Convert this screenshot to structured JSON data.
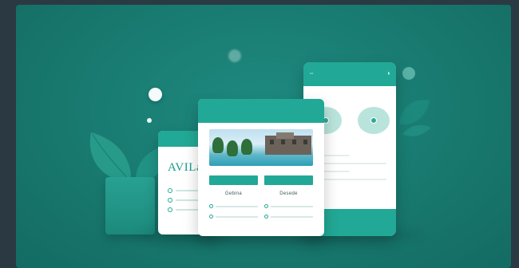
{
  "brand": {
    "logo_text": "AVILa",
    "tagline": "",
    "color_primary": "#22a896",
    "color_background": "#18796f"
  },
  "left_card": {
    "header": "",
    "subheading": ""
  },
  "center_card": {
    "header_left": "",
    "header_center": "",
    "header_right": "",
    "columns": [
      {
        "button_label": "",
        "title": "Gebina",
        "subtitle": ""
      },
      {
        "button_label": "",
        "title": "Desede",
        "subtitle": ""
      }
    ]
  },
  "right_card": {
    "status_title": "",
    "header_title": "",
    "label": ""
  },
  "icons": [
    "leaf-icon",
    "home-button-icon",
    "list-bullet-icon"
  ]
}
